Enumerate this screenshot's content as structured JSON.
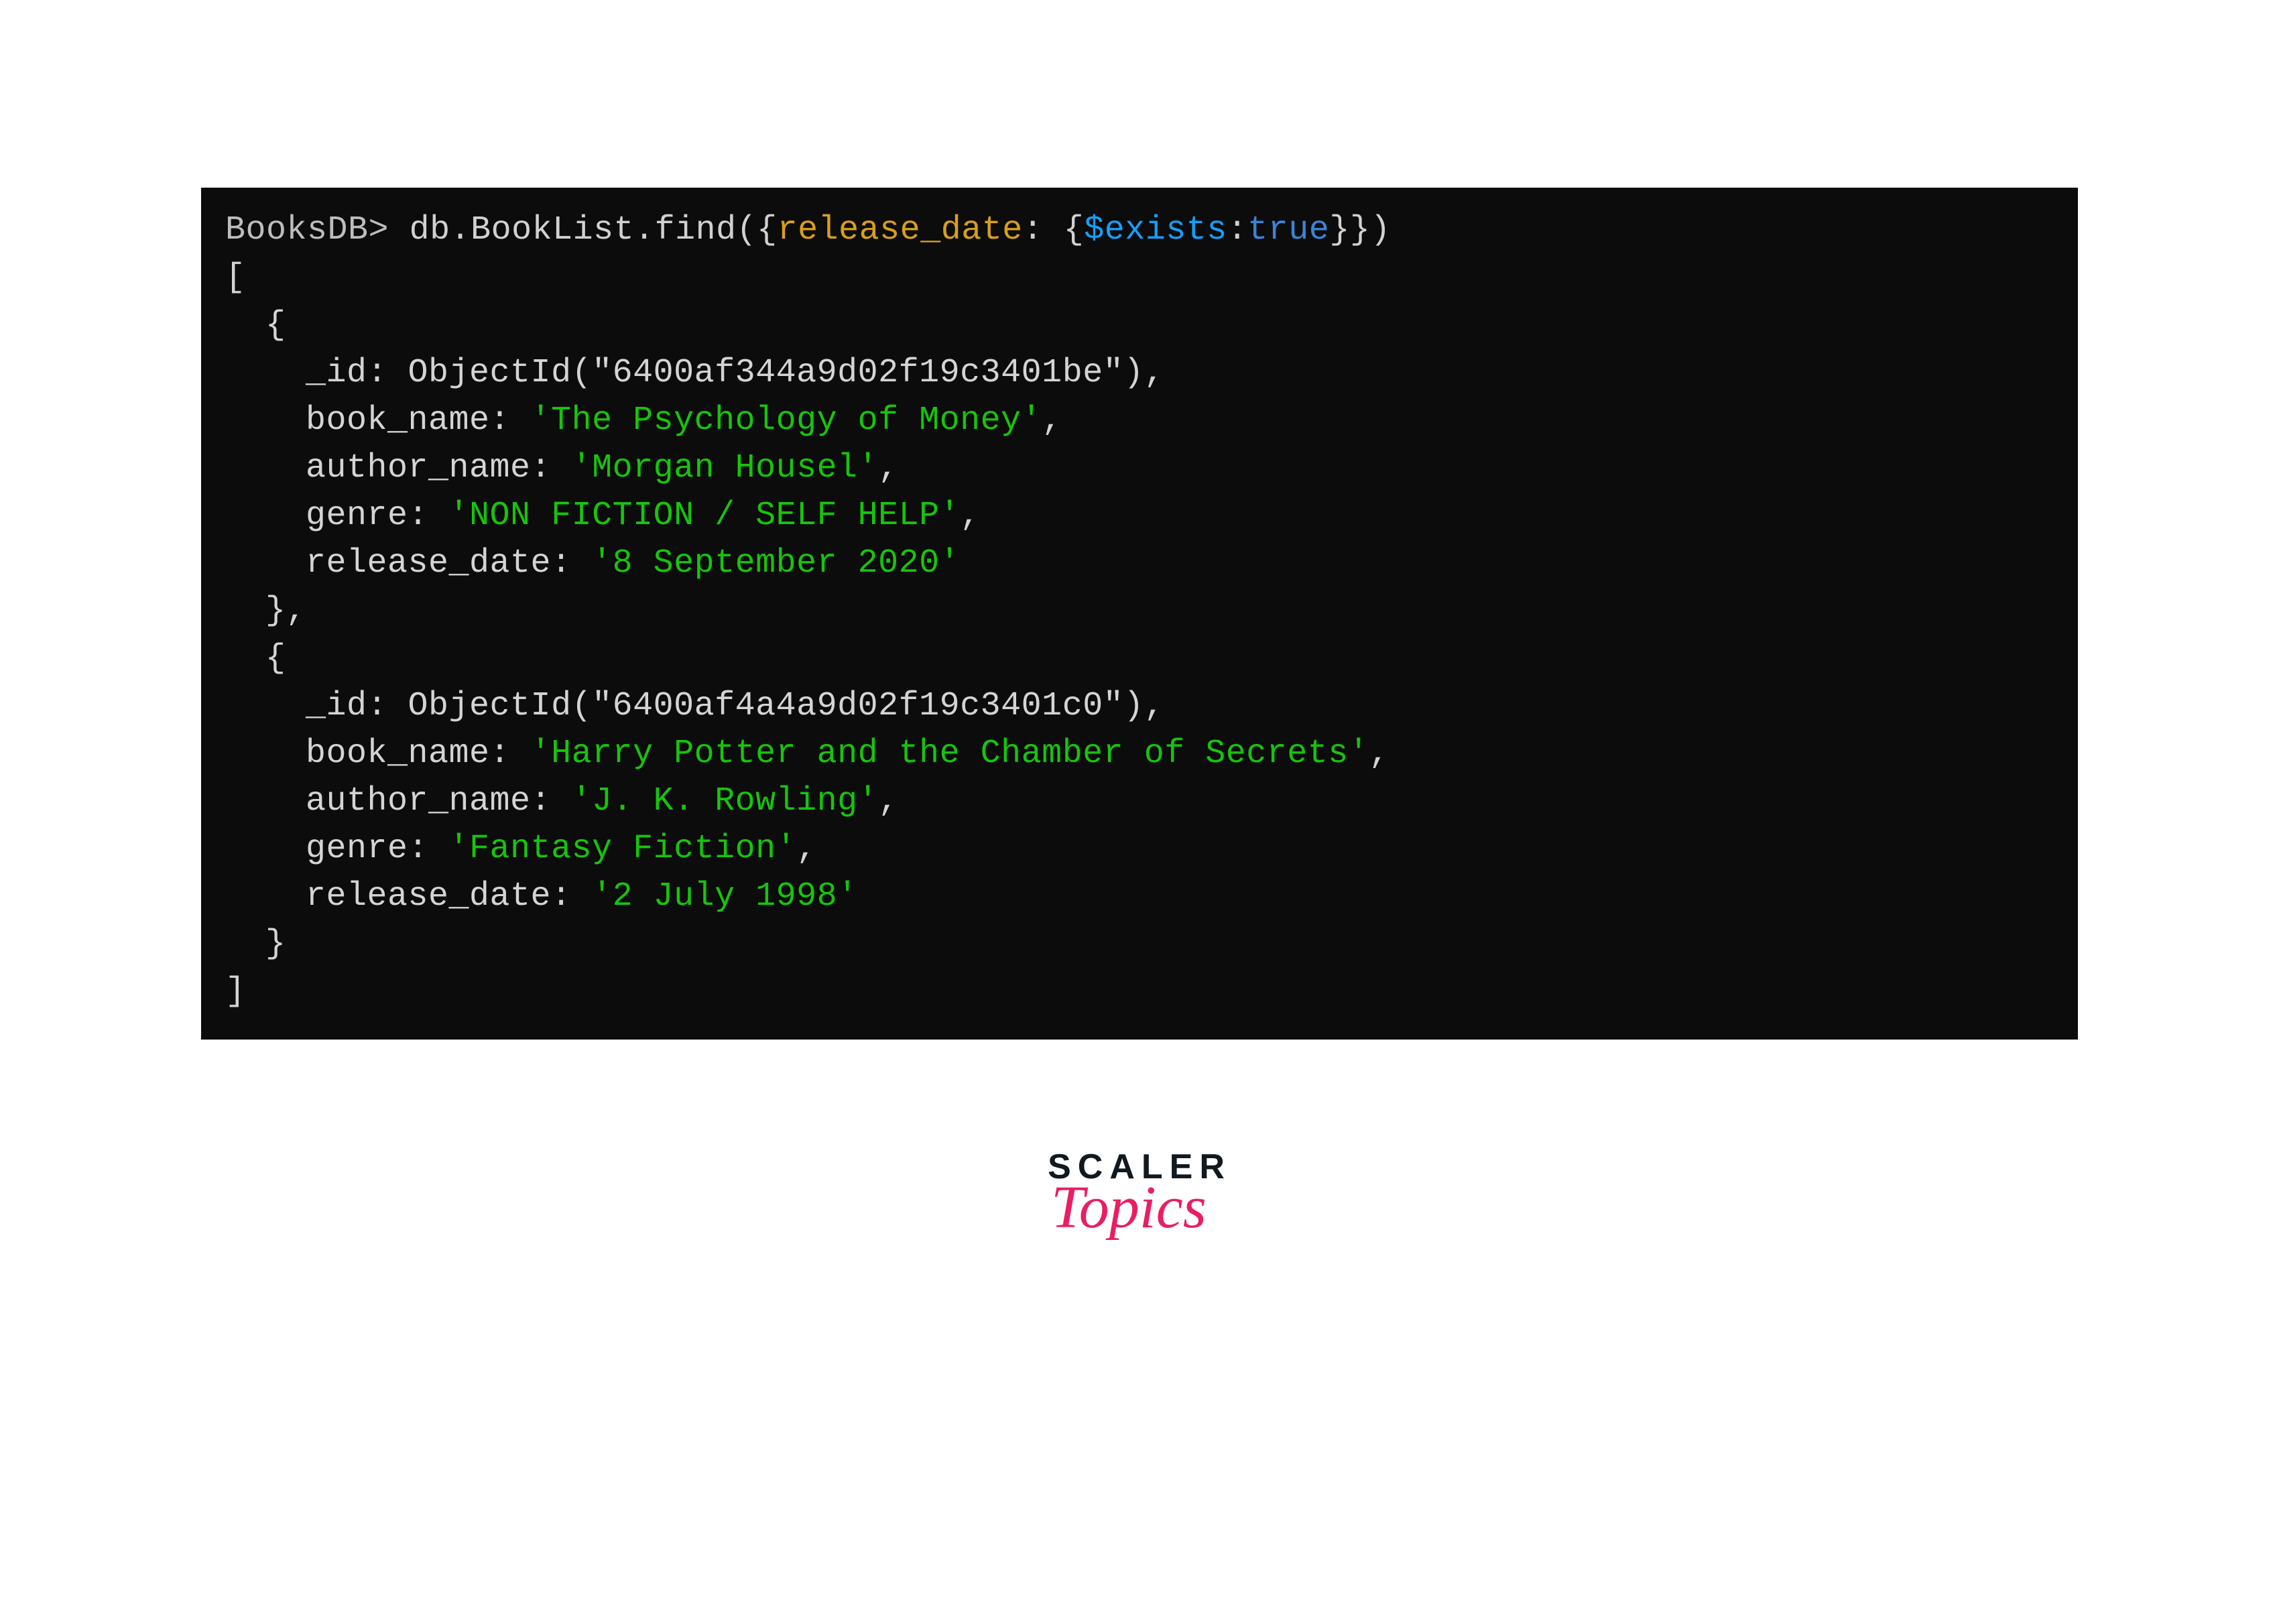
{
  "terminal": {
    "prompt": "BooksDB>",
    "command_prefix": "db.BookList.find({",
    "arg_key": "release_date",
    "arg_sep": ": {",
    "arg_op": "$exists",
    "arg_colon": ":",
    "arg_true": "true",
    "command_suffix": "}})",
    "open_bracket": "[",
    "close_bracket": "]",
    "obj_open": "{",
    "obj_close_comma": "},",
    "obj_close": "}",
    "records": [
      {
        "id_key": "_id",
        "id_func": "ObjectId(",
        "id_val": "\"6400af344a9d02f19c3401be\"",
        "id_close": "),",
        "book_name_key": "book_name",
        "book_name_val": "'The Psychology of Money'",
        "author_name_key": "author_name",
        "author_name_val": "'Morgan Housel'",
        "genre_key": "genre",
        "genre_val": "'NON FICTION / SELF HELP'",
        "release_date_key": "release_date",
        "release_date_val": "'8 September 2020'"
      },
      {
        "id_key": "_id",
        "id_func": "ObjectId(",
        "id_val": "\"6400af4a4a9d02f19c3401c0\"",
        "id_close": "),",
        "book_name_key": "book_name",
        "book_name_val": "'Harry Potter and the Chamber of Secrets'",
        "author_name_key": "author_name",
        "author_name_val": "'J. K. Rowling'",
        "genre_key": "genre",
        "genre_val": "'Fantasy Fiction'",
        "release_date_key": "release_date",
        "release_date_val": "'2 July 1998'"
      }
    ]
  },
  "brand": {
    "scaler": "SCALER",
    "topics": "Topics"
  },
  "colors": {
    "terminal_bg": "#0c0c0c",
    "prompt": "#bdbdbd",
    "command": "#d1d1d1",
    "arg_key": "#d8a018",
    "arg_op": "#14a0ff",
    "arg_true": "#3b84d6",
    "output_default": "#d4d4d4",
    "string": "#16c50b",
    "brand_text": "#101820",
    "brand_script": "#e91e63"
  }
}
